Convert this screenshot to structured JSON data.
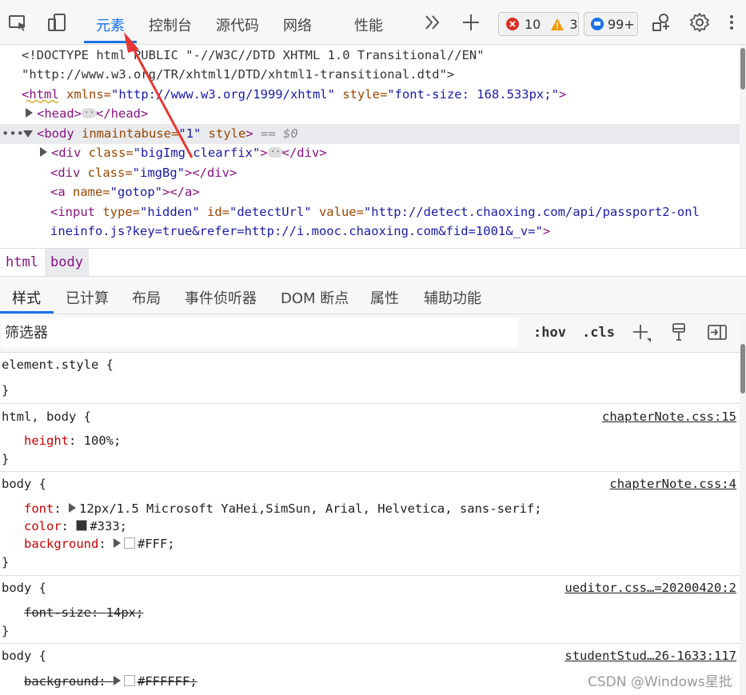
{
  "toolbar": {
    "tabs": [
      "元素",
      "控制台",
      "源代码",
      "网络",
      "性能"
    ],
    "errors": "10",
    "warnings": "3",
    "messages": "99+",
    "icons": [
      "inspect-icon",
      "device-toolbar-icon",
      "more-tabs-icon",
      "add-tab-icon",
      "error-icon",
      "warning-icon",
      "message-icon",
      "customize-icon",
      "settings-icon",
      "kebab-menu-icon"
    ]
  },
  "dom": {
    "line1": "<!DOCTYPE html PUBLIC \"-//W3C//DTD XHTML 1.0 Transitional//EN\"",
    "line2": "\"http://www.w3.org/TR/xhtml1/DTD/xhtml1-transitional.dtd\">",
    "html_tag": "<html",
    "html_xmlns_attr": " xmlns=",
    "html_xmlns_val": "\"http://www.w3.org/1999/xhtml\"",
    "html_style_attr": " style=",
    "html_style_val": "\"font-size: 168.533px;\"",
    "html_close": ">",
    "head_open": "<head>",
    "head_close": "</head>",
    "body_open": "<body",
    "body_attr1": " inmaintabuse=",
    "body_val1": "\"1\"",
    "body_attr2": " style",
    "body_close": ">",
    "body_eq": " == $0",
    "div1_open": "<div",
    "div1_attr": " class=",
    "div1_val": "\"bigImg clearfix\"",
    "div1_close": ">",
    "div1_end": "</div>",
    "div2_open": "<div",
    "div2_attr": " class=",
    "div2_val": "\"imgBg\"",
    "div2_close": "></div>",
    "a_open": "<a",
    "a_attr": " name=",
    "a_val": "\"gotop\"",
    "a_close": "></a>",
    "input_open": "<input",
    "input_attr1": " type=",
    "input_val1": "\"hidden\"",
    "input_attr2": " id=",
    "input_val2": "\"detectUrl\"",
    "input_attr3": " value=",
    "input_val3a": "\"http://detect.chaoxing.com/api/passport2-onl",
    "input_val3b": "ineinfo.js?key=true&refer=http://i.mooc.chaoxing.com&fid=1001&_v=\"",
    "input_close": ">"
  },
  "breadcrumb": [
    "html",
    "body"
  ],
  "subtabs": [
    "样式",
    "已计算",
    "布局",
    "事件侦听器",
    "DOM 断点",
    "属性",
    "辅助功能"
  ],
  "filter": {
    "placeholder": "筛选器",
    "hov": ":hov",
    "cls": ".cls"
  },
  "styles": {
    "rule0": {
      "selector": "element.style {",
      "close": "}"
    },
    "rule1": {
      "selector": "html, body {",
      "source": "chapterNote.css:15",
      "prop": "height",
      "value": "100%;",
      "close": "}"
    },
    "rule2": {
      "selector": "body {",
      "source": "chapterNote.css:4",
      "p1": "font",
      "v1": "12px/1.5 Microsoft YaHei,SimSun, Arial, Helvetica, sans-serif;",
      "p2": "color",
      "v2": "#333;",
      "p3": "background",
      "v3": "#FFF;",
      "close": "}"
    },
    "rule3": {
      "selector": "body {",
      "source": "ueditor.css…=20200420:2",
      "prop": "font-size",
      "value": "14px;",
      "close": "}"
    },
    "rule4": {
      "selector": "body {",
      "source": "studentStud…26-1633:117",
      "prop": "background",
      "value": "#FFFFFF;"
    }
  },
  "colors": {
    "accent": "#1a73e8",
    "swatch_dark": "#333333",
    "swatch_white": "#ffffff",
    "arrow": "#e53935"
  },
  "watermark": "CSDN @Windows星批"
}
